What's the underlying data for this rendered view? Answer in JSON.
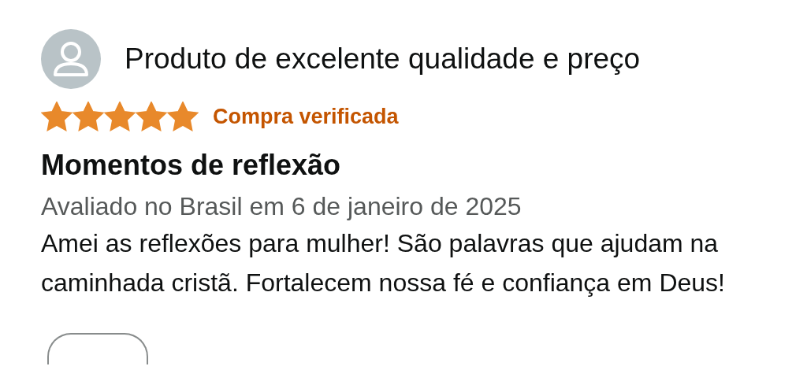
{
  "review": {
    "author": "Produto de excelente qualidade e preço",
    "stars": 5,
    "badge": "Compra verificada",
    "title": "Momentos de reflexão",
    "date": "Avaliado no Brasil em 6 de janeiro de 2025",
    "body": "Amei as reflexões para mulher! São palavras que ajudam na caminhada cristã. Fortalecem nossa fé e confiança em Deus!"
  }
}
